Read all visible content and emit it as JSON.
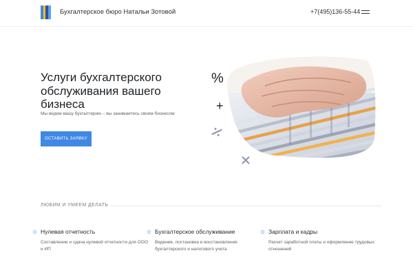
{
  "header": {
    "brand": "Бухгалтерское бюро Натальи Зотовой",
    "phone": "+7(495)136-55-44"
  },
  "hero": {
    "title": "Услуги бухгалтерского обслуживания вашего бизнеса",
    "subtitle": "Мы ведем вашу бухгалтерию – вы занимаетесь своим бизнесом",
    "cta_label": "ОСТАВИТЬ ЗАЯВКУ",
    "symbols": {
      "percent": "%",
      "plus": "+"
    }
  },
  "section": {
    "label": "ЛЮБИМ И УМЕЕМ ДЕЛАТЬ",
    "services": [
      {
        "title": "Нулевая отчетность",
        "desc": "Составление и сдача нулевой отчетности для ООО и ИП"
      },
      {
        "title": "Бухгалтерское обслуживание",
        "desc": "Ведение, постановка и восстановление бухгалтерского и налогового учета"
      },
      {
        "title": "Зарплата и кадры",
        "desc": "Расчет заработной платы и оформление трудовых отношений"
      }
    ]
  },
  "colors": {
    "accent": "#3f88e3",
    "logo": [
      "#3f88e3",
      "#f4c21b",
      "#2f4fa8"
    ]
  },
  "icons": [
    "logo-icon",
    "menu-icon",
    "percent-icon",
    "plus-icon",
    "multiply-icon",
    "divide-icon"
  ]
}
